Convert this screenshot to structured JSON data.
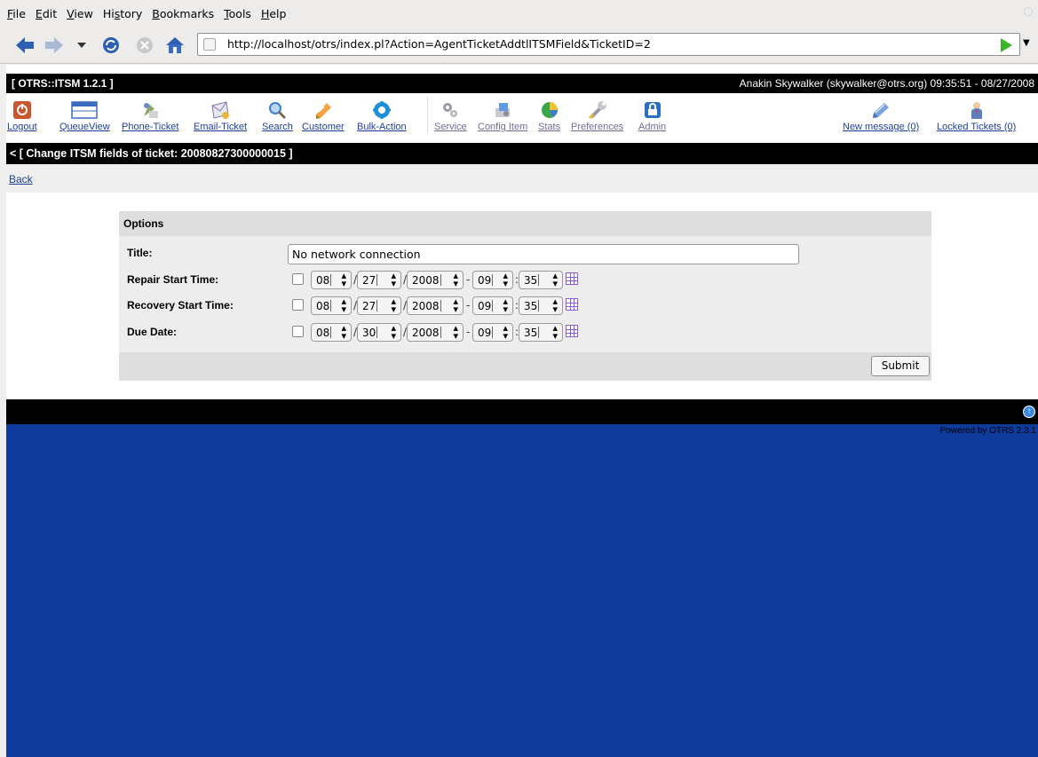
{
  "browser": {
    "menu": [
      {
        "u": "F",
        "rest": "ile"
      },
      {
        "u": "E",
        "rest": "dit"
      },
      {
        "u": "V",
        "rest": "iew"
      },
      {
        "pre": "Hi",
        "u": "s",
        "rest": "tory"
      },
      {
        "u": "B",
        "rest": "ookmarks"
      },
      {
        "u": "T",
        "rest": "ools"
      },
      {
        "u": "H",
        "rest": "elp"
      }
    ],
    "url": "http://localhost/otrs/index.pl?Action=AgentTicketAddtlITSMField&TicketID=2"
  },
  "app": {
    "title": "[ OTRS::ITSM 1.2.1 ]",
    "user_info": "Anakin Skywalker (skywalker@otrs.org) 09:35:51 - 08/27/2008"
  },
  "toolbar": {
    "logout": "Logout",
    "queueview": "QueueView",
    "phone_ticket": "Phone-Ticket",
    "email_ticket": "Email-Ticket",
    "search": "Search",
    "customer": "Customer",
    "bulk_action": "Bulk-Action",
    "service": "Service",
    "config_item": "Config Item",
    "stats": "Stats",
    "preferences": "Preferences",
    "admin": "Admin",
    "new_message": "New message (0)",
    "locked_tickets": "Locked Tickets (0)"
  },
  "page": {
    "heading": "< [ Change ITSM fields of ticket: 20080827300000015 ]",
    "back": "Back",
    "options_title": "Options",
    "title_label": "Title:",
    "title_value": "No network connection",
    "fields": [
      {
        "label": "Repair Start Time:",
        "month": "08",
        "day": "27",
        "year": "2008",
        "hour": "09",
        "minute": "35"
      },
      {
        "label": "Recovery Start Time:",
        "month": "08",
        "day": "27",
        "year": "2008",
        "hour": "09",
        "minute": "35"
      },
      {
        "label": "Due Date:",
        "month": "08",
        "day": "30",
        "year": "2008",
        "hour": "09",
        "minute": "35"
      }
    ],
    "date_sep": "/",
    "time_sep": "-",
    "hm_sep": ":",
    "submit": "Submit",
    "powered": "Powered by OTRS 2.3.1"
  }
}
